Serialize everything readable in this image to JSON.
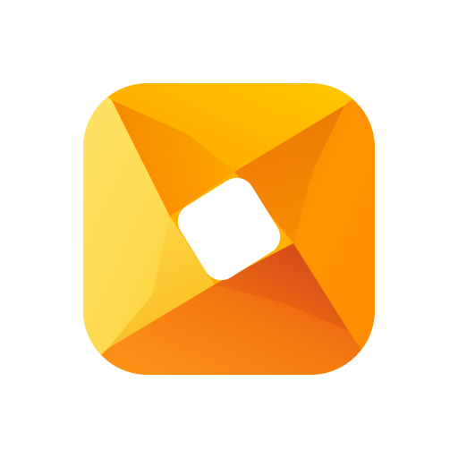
{
  "icon": {
    "name": "app-logo-icon",
    "colors": {
      "yellow_light": "#FFE36B",
      "yellow": "#FFCC1A",
      "yellow_deep": "#FFB800",
      "orange_light": "#FFA31A",
      "orange": "#FF8A00",
      "orange_deep": "#F26B0F",
      "red_orange": "#E55A17",
      "center": "#FFFFFF",
      "background": "#FFFFFF"
    }
  }
}
